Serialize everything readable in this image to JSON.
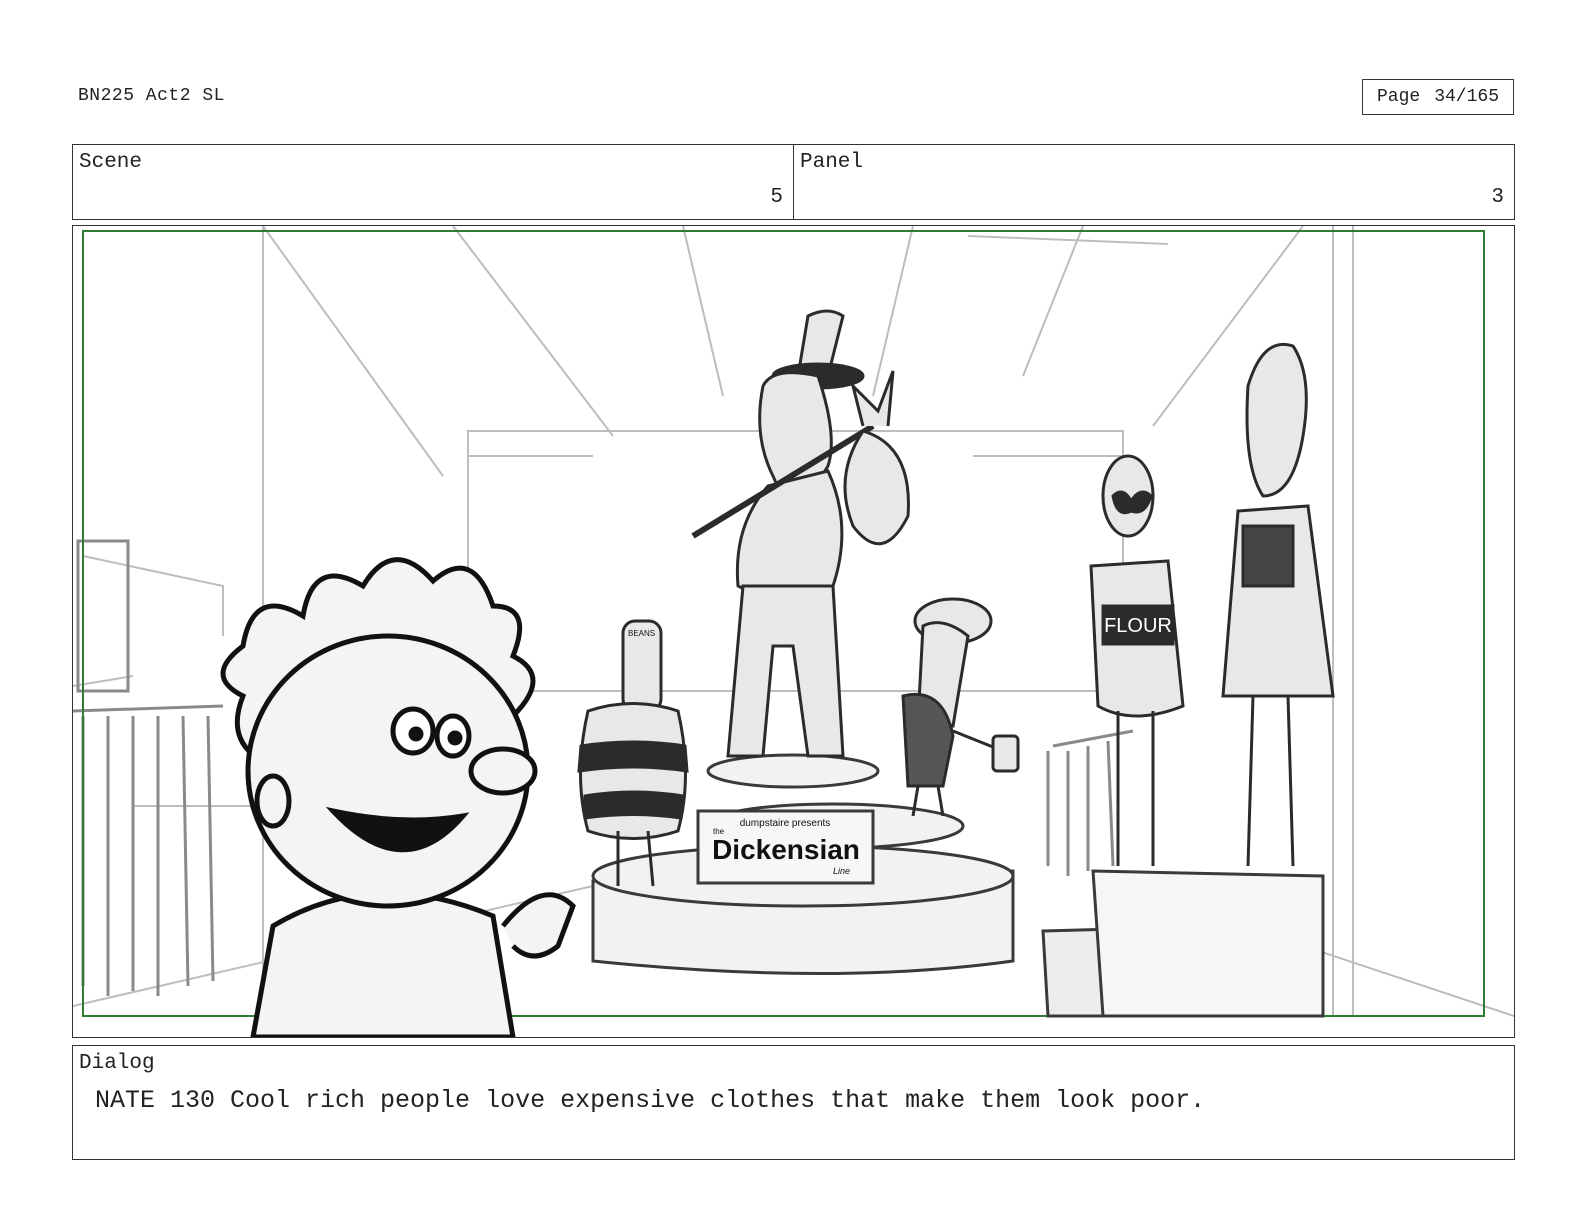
{
  "header": {
    "doc_title": "BN225 Act2 SL",
    "page_label": "Page",
    "page_value": "34/165"
  },
  "info": {
    "scene_label": "Scene",
    "scene_value": "5",
    "panel_label": "Panel",
    "panel_value": "3"
  },
  "artwork": {
    "sign_top": "dumpstaire presents",
    "sign_the": "the",
    "sign_title": "Dickensian",
    "sign_line": "Line",
    "shirt_text": "FLOUR",
    "can_text": "BEANS",
    "frame_color": "#2e7d32"
  },
  "dialog": {
    "label": "Dialog",
    "line": "NATE 130 Cool rich people love expensive clothes that make them look poor."
  }
}
